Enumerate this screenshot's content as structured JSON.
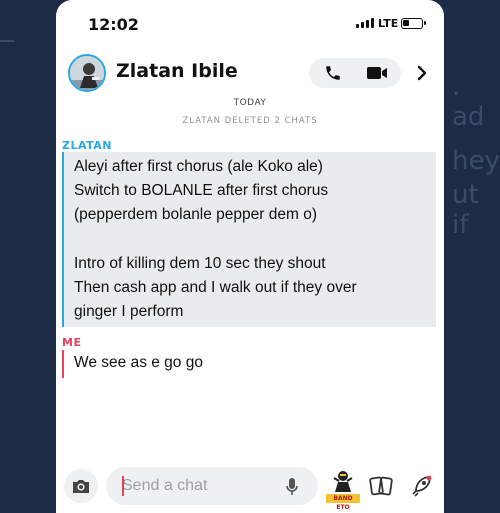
{
  "status_bar": {
    "time": "12:02",
    "network": "LTE",
    "battery_level": 0.35
  },
  "header": {
    "contact_name": "Zlatan Ibile",
    "icons": [
      "phone-icon",
      "video-icon",
      "chevron-right-icon"
    ]
  },
  "chat": {
    "day_label": "TODAY",
    "system_notice": "ZLATAN DELETED 2 CHATS",
    "messages": [
      {
        "sender": "ZLATAN",
        "lines": [
          "Aleyi after first chorus (ale Koko ale)",
          "Switch to BOLANLE after first chorus",
          "(pepperdem bolanle pepper dem o)",
          "",
          "Intro of killing dem 10 sec they shout",
          "Then cash app and I walk out if they over",
          "ginger I perform"
        ]
      },
      {
        "sender": "ME",
        "lines": [
          "We see as e go go"
        ]
      }
    ]
  },
  "composer": {
    "placeholder": "Send a chat",
    "sticker_text": "BAND ETO",
    "icons": [
      "camera-icon",
      "microphone-icon",
      "sticker-icon",
      "cards-icon",
      "rocket-icon"
    ]
  },
  "colors": {
    "them_accent": "#2aa6e3",
    "me_accent": "#e8415d",
    "background": "#1d2b45"
  }
}
